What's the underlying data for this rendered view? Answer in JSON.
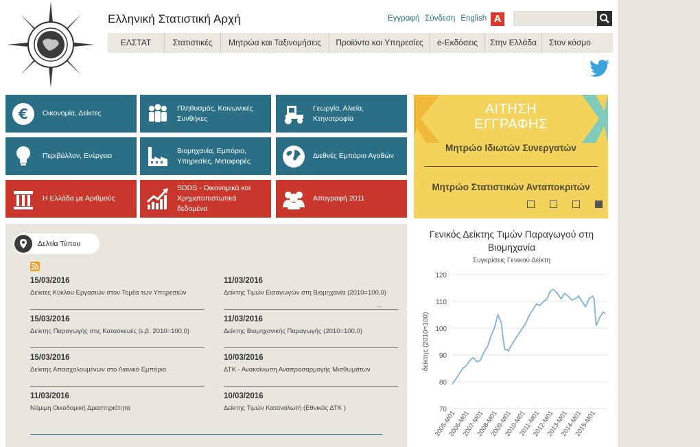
{
  "header": {
    "site_title": "Ελληνική Στατιστική Αρχή",
    "links": [
      "Εγγραφή",
      "Σύνδεση",
      "English"
    ],
    "a_button": "A",
    "search_placeholder": ""
  },
  "nav": {
    "items": [
      "ΕΛΣΤΑΤ",
      "Στατιστικές",
      "Μητρώα και Ταξινομήσεις",
      "Προϊόντα και Υπηρεσίες",
      "e-Εκδόσεις",
      "Στην Ελλάδα",
      "Στον κόσμο"
    ]
  },
  "tiles": [
    {
      "label": "Οικονομία, Δείκτες",
      "icon": "euro-icon",
      "color": "teal"
    },
    {
      "label": "Πληθυσμός, Κοινωνικές Συνθήκες",
      "icon": "people-icon",
      "color": "teal"
    },
    {
      "label": "Γεωργία, Αλιεία, Κτηνοτροφία",
      "icon": "tractor-icon",
      "color": "teal"
    },
    {
      "label": "Περιβάλλον, Ενέργεια",
      "icon": "lightbulb-icon",
      "color": "teal"
    },
    {
      "label": "Βιομηχανία, Εμπόριο, Υπηρεσίες, Μεταφορές",
      "icon": "factory-icon",
      "color": "teal"
    },
    {
      "label": "Διεθνές Εμπόριο Αγαθών",
      "icon": "globe-icon",
      "color": "teal"
    },
    {
      "label": "Η Ελλάδα με Αριθμούς",
      "icon": "column-icon",
      "color": "red"
    },
    {
      "label": "SDDS - Οικονομικά και Χρηματοπιστωτικά δεδομένα",
      "icon": "growth-chart-icon",
      "color": "red"
    },
    {
      "label": "Απογραφή 2011",
      "icon": "group-icon",
      "color": "red"
    }
  ],
  "banner": {
    "title_line1": "ΑΙΤΗΣΗ",
    "title_line2": "ΕΓΓΡΑΦΗΣ",
    "subtitle1": "Μητρώο Ιδιωτών Συνεργατών",
    "subtitle2": "Μητρώο Στατιστικών Ανταποκριτών",
    "active_slide": 4,
    "slide_count": 4
  },
  "press": {
    "heading": "Δελτία Τύπου",
    "items": [
      {
        "date": "15/03/2016",
        "title": "Δείκτες Κύκλου Εργασιών στον Τομέα των Υπηρεσιών"
      },
      {
        "date": "11/03/2016",
        "title": "Δείκτης Τιμών Εισαγωγών στη Βιομηχανία (2010=100,0)"
      },
      {
        "date": "15/03/2016",
        "title": "Δείκτης Παραγωγής στις Κατασκευές (ε.β. 2010=100,0)"
      },
      {
        "date": "11/03/2016",
        "title": "Δείκτης Βιομηχανικής Παραγωγής (2010=100,0)"
      },
      {
        "date": "15/03/2016",
        "title": "Δείκτης Απασχολουμένων στο Λιανικό Εμπόριο"
      },
      {
        "date": "10/03/2016",
        "title": "ΔΤΚ - Ανακοίνωση Αναπροσαρμογής Μισθωμάτων"
      },
      {
        "date": "11/03/2016",
        "title": "Νόμιμη Οικοδομική Δραστηριότητα"
      },
      {
        "date": "10/03/2016",
        "title": "Δείκτης Τιμών Καταναλωτή (Εθνικός ΔΤΚ )"
      }
    ],
    "more": "..."
  },
  "chart_data": {
    "type": "line",
    "title": "Γενικός Δείκτης Τιμών Παραγωγού στη Βιομηχανία",
    "subtitle": "Συγκρίσεις Γενικού Δείκτη",
    "ylabel": "δείκτης (2010=100)",
    "xlabel": "",
    "ylim": [
      70,
      120
    ],
    "yticks": [
      70,
      80,
      90,
      100,
      110,
      120
    ],
    "xticks": [
      "2005-M01",
      "2006-M01",
      "2007-M01",
      "2008-M01",
      "2009-M01",
      "2010-M01",
      "2011-M01",
      "2012-M01",
      "2013-M01",
      "2014-M01",
      "2015-M01"
    ],
    "grid": true,
    "color": "#7fb3d5",
    "series": [
      {
        "x": [
          2005.0,
          2005.25,
          2005.5,
          2005.75,
          2006.0,
          2006.25,
          2006.5,
          2006.75,
          2007.0,
          2007.25,
          2007.5,
          2007.75,
          2008.0,
          2008.25,
          2008.5,
          2008.6,
          2008.75,
          2008.9,
          2009.0,
          2009.25,
          2009.5,
          2009.75,
          2010.0,
          2010.25,
          2010.5,
          2010.75,
          2011.0,
          2011.25,
          2011.5,
          2011.75,
          2012.0,
          2012.2,
          2012.5,
          2012.75,
          2013.0,
          2013.25,
          2013.5,
          2013.75,
          2014.0,
          2014.25,
          2014.5,
          2014.75,
          2015.0,
          2015.1,
          2015.25,
          2015.5,
          2015.75,
          2015.9
        ],
        "values": [
          79,
          81,
          83,
          85,
          86,
          88,
          89,
          87.5,
          88,
          91,
          93,
          97,
          100,
          105,
          102,
          97,
          92,
          92,
          91.5,
          94,
          96,
          98,
          100,
          102,
          105,
          107,
          109,
          108.5,
          110,
          111,
          114,
          114.5,
          113,
          111,
          113,
          112,
          110.5,
          111,
          112,
          110,
          108,
          111,
          112,
          111,
          101,
          104,
          106,
          105.5
        ]
      }
    ]
  }
}
